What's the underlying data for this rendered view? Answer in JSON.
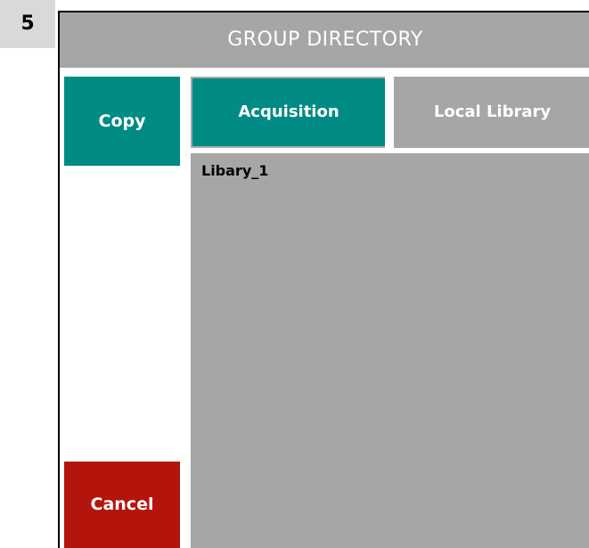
{
  "step": {
    "number": "5"
  },
  "window": {
    "title": "GROUP DIRECTORY"
  },
  "actions": {
    "copy_label": "Copy",
    "cancel_label": "Cancel"
  },
  "tabs": [
    {
      "label": "Acquisition",
      "active": true
    },
    {
      "label": "Local Library",
      "active": false
    }
  ],
  "list": {
    "items": [
      {
        "label": "Libary_1"
      }
    ]
  },
  "colors": {
    "accent_teal": "#008b84",
    "cancel_red": "#b3140c",
    "panel_gray": "#a6a6a6",
    "badge_gray": "#d9d9d9"
  }
}
